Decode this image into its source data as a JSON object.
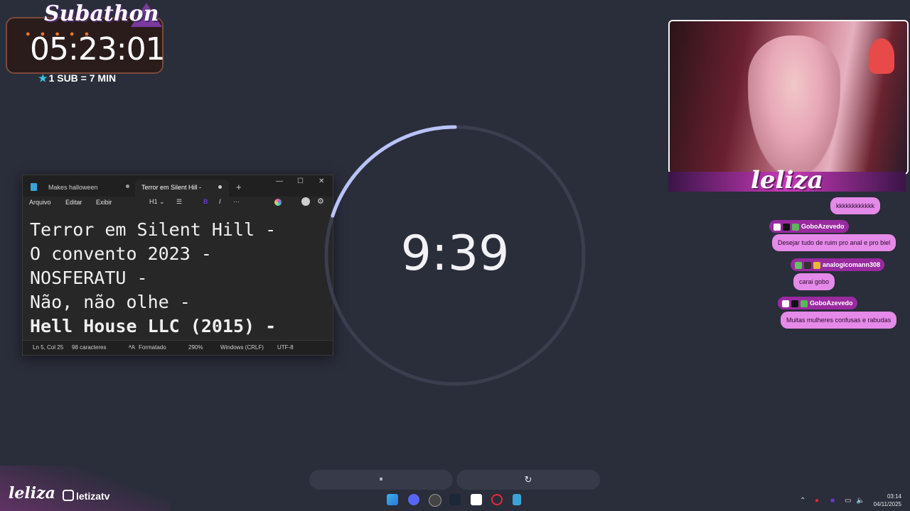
{
  "subathon": {
    "title": "Subathon",
    "timer": "05:23:01",
    "rate": "1 SUB = 7 MIN"
  },
  "notepad": {
    "tabs": [
      "Makes halloween",
      "Terror em Silent Hill -"
    ],
    "menu": [
      "Arquivo",
      "Editar",
      "Exibir"
    ],
    "heading_tool": "H1",
    "lines": [
      "Terror em Silent Hill -",
      "O convento 2023 -",
      "NOSFERATU -",
      "Não, não olhe -",
      "Hell House LLC (2015) -"
    ],
    "status": {
      "position": "Ln 5, Col 25",
      "chars": "98 caracteres",
      "format": "Formatado",
      "zoom": "290%",
      "line_ending": "Windows (CRLF)",
      "encoding": "UTF-8"
    }
  },
  "clock": {
    "time": "9:39",
    "progress": 0.2,
    "accent": "#b8c4f8",
    "track": "#3a3e4e"
  },
  "webcam": {
    "name_logo": "leliza"
  },
  "chat": [
    {
      "user": "",
      "message": "kkkkkkkkkkkk"
    },
    {
      "user": "GoboAzevedo",
      "message": "Desejar tudo de ruim pro anal e pro biel"
    },
    {
      "user": "analogicomann308",
      "message": "carai gobo"
    },
    {
      "user": "GoboAzevedo",
      "message": "Muitas mulheres confusas e rabudas"
    }
  ],
  "controls": {
    "pause": "⏸",
    "reset": "↻"
  },
  "branding": {
    "logo": "leliza",
    "handle": "letizatv"
  },
  "system_clock": {
    "time": "03:14",
    "date": "04/11/2025"
  }
}
